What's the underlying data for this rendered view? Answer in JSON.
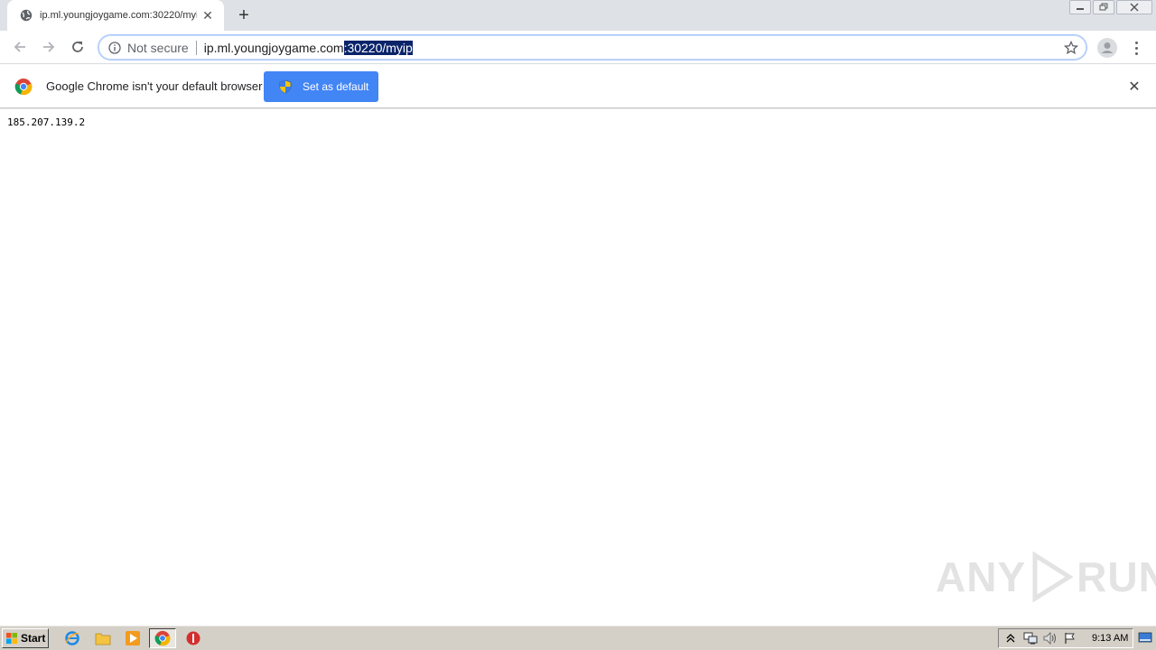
{
  "tab": {
    "title": "ip.ml.youngjoygame.com:30220/myip",
    "close_glyph": "✕",
    "favicon": "globe-icon"
  },
  "newtab_glyph": "+",
  "omnibox": {
    "security_label": "Not secure",
    "url_host": "ip.ml.youngjoygame.com",
    "url_selected": ":30220/myip"
  },
  "infobar": {
    "message": "Google Chrome isn't your default browser",
    "button_label": "Set as default",
    "close_glyph": "✕"
  },
  "page": {
    "text": "185.207.139.2"
  },
  "watermark": {
    "left": "ANY",
    "right": "RUN"
  },
  "taskbar": {
    "start_label": "Start",
    "clock": "9:13 AM"
  },
  "colors": {
    "accent": "#4285f4",
    "selection": "#0a246a",
    "taskbar": "#d4d0c8"
  }
}
